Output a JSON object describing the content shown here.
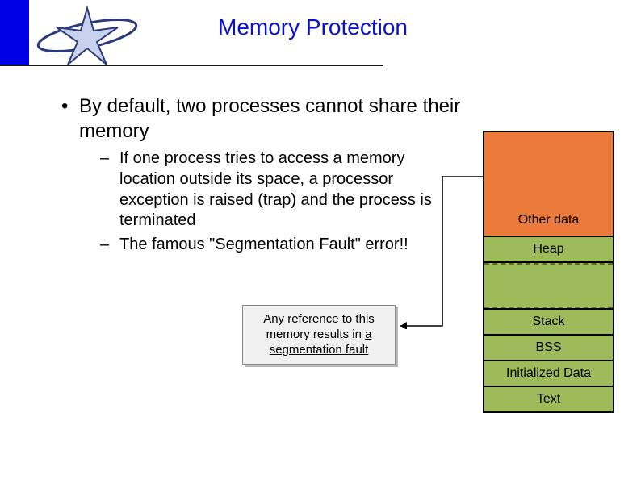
{
  "title": "Memory Protection",
  "bullets": {
    "main": "By default, two processes cannot share their memory",
    "sub1": "If one process tries to access a memory location outside its space, a processor exception is raised (trap) and the process is terminated",
    "sub2": "The famous \"Segmentation Fault\" error!!"
  },
  "note": {
    "line1": "Any reference to this",
    "line2_a": "memory results in ",
    "line2_b": "a",
    "line3": "segmentation fault"
  },
  "mem": {
    "other": "Other data",
    "heap": "Heap",
    "stack": "Stack",
    "bss": "BSS",
    "init": "Initialized Data",
    "text": "Text"
  },
  "colors": {
    "title": "#0a11d2",
    "seg_green": "#9dbb5b",
    "seg_orange": "#ec7a3a"
  }
}
